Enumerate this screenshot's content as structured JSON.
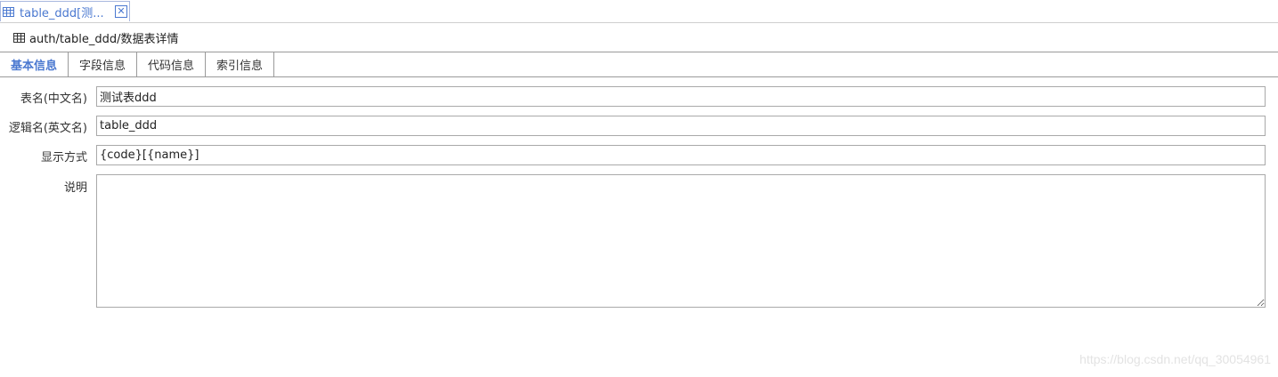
{
  "doc_tab": {
    "label": "table_ddd[测...",
    "close_glyph": "✕",
    "icon": "table-grid-icon"
  },
  "breadcrumb": {
    "icon": "table-grid-icon",
    "text": "auth/table_ddd/数据表详情"
  },
  "tabs": [
    {
      "label": "基本信息",
      "active": true
    },
    {
      "label": "字段信息",
      "active": false
    },
    {
      "label": "代码信息",
      "active": false
    },
    {
      "label": "索引信息",
      "active": false
    }
  ],
  "form": {
    "cn_name": {
      "label": "表名(中文名)",
      "value": "测试表ddd"
    },
    "en_name": {
      "label": "逻辑名(英文名)",
      "value": "table_ddd"
    },
    "display": {
      "label": "显示方式",
      "value": "{code}[{name}]"
    },
    "description": {
      "label": "说明",
      "value": ""
    }
  },
  "watermark": "https://blog.csdn.net/qq_30054961",
  "colors": {
    "accent": "#4a78d0",
    "border": "#a9a9a9"
  }
}
